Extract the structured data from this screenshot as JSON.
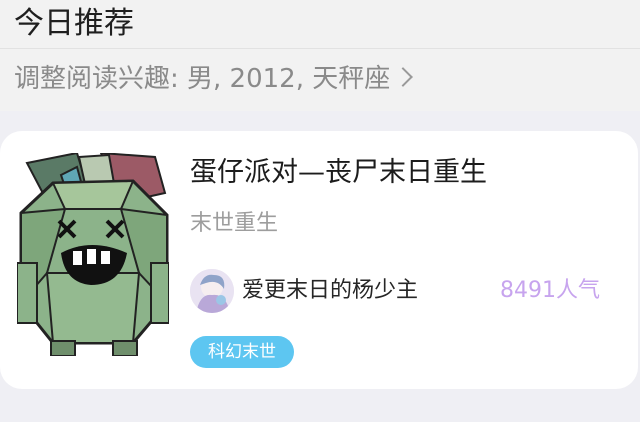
{
  "section": {
    "title": "今日推荐",
    "interest_text": "调整阅读兴趣: 男, 2012, 天秤座"
  },
  "book": {
    "title": "蛋仔派对—丧尸末日重生",
    "tagline": "末世重生",
    "author": "爱更末日的杨少主",
    "popularity": "8491人气",
    "genre": "科幻末世"
  },
  "icons": [
    "chevron-right-icon",
    "book-cover-image",
    "author-avatar"
  ],
  "colors": {
    "background": "#efeff4",
    "card": "#ffffff",
    "popularity": "#c7a4ee",
    "genre_tag": "#5dc6f1"
  }
}
